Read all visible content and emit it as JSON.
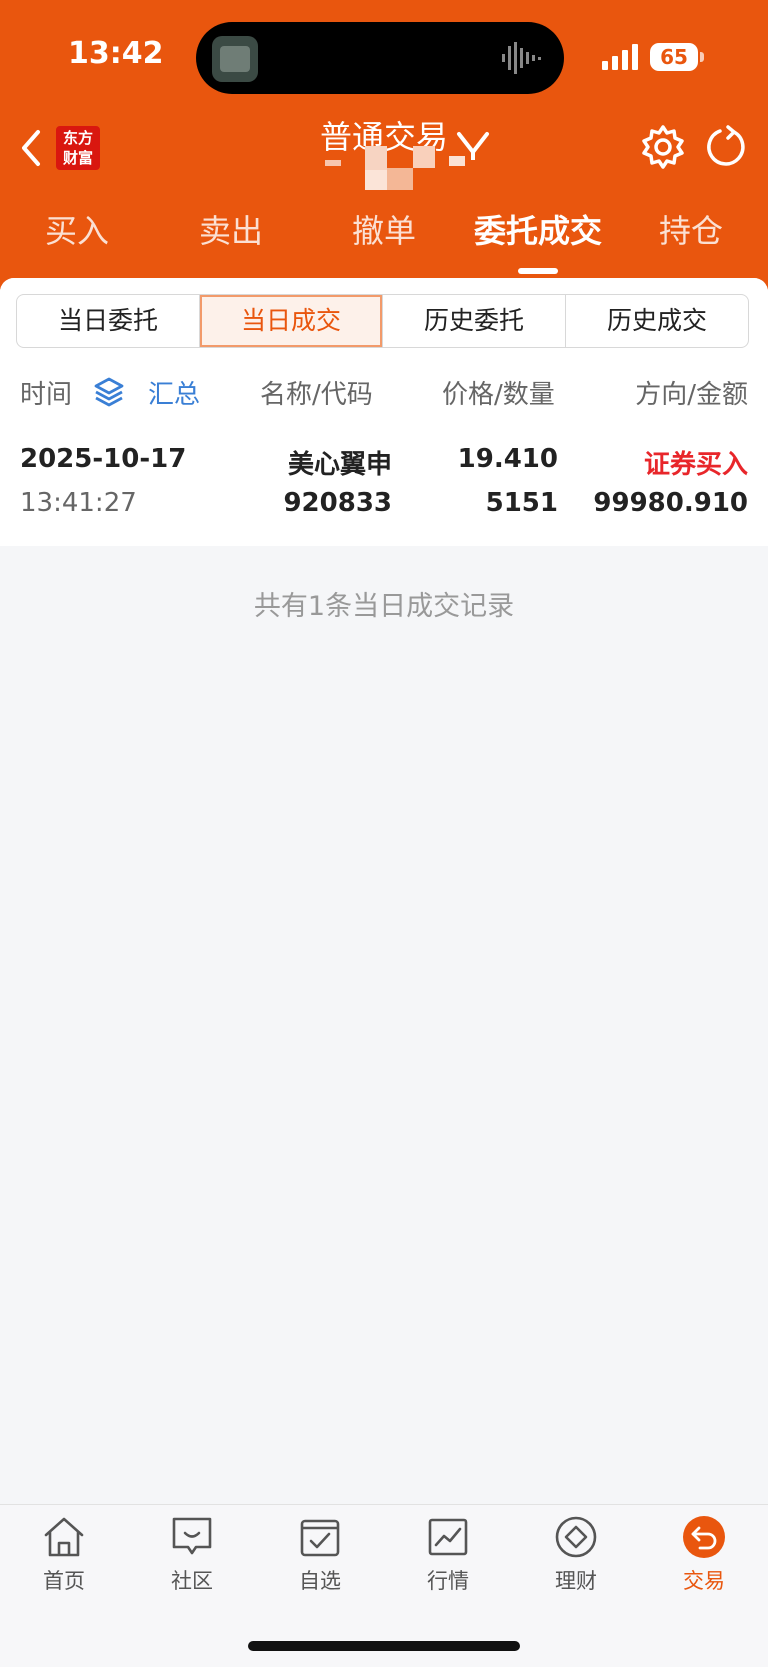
{
  "status_bar": {
    "time": "13:42",
    "battery": "65"
  },
  "header": {
    "logo_line1": "东方",
    "logo_line2": "财富",
    "title": "普通交易"
  },
  "main_tabs": [
    {
      "label": "买入"
    },
    {
      "label": "卖出"
    },
    {
      "label": "撤单"
    },
    {
      "label": "委托成交",
      "active": true
    },
    {
      "label": "持仓"
    }
  ],
  "sub_tabs": [
    {
      "label": "当日委托"
    },
    {
      "label": "当日成交",
      "active": true
    },
    {
      "label": "历史委托"
    },
    {
      "label": "历史成交"
    }
  ],
  "columns": {
    "time": "时间",
    "summary": "汇总",
    "name_code": "名称/代码",
    "price_qty": "价格/数量",
    "dir_amount": "方向/金额"
  },
  "trades": [
    {
      "date": "2025-10-17",
      "time": "13:41:27",
      "name": "美心翼申",
      "code": "920833",
      "price": "19.410",
      "quantity": "5151",
      "direction": "证券买入",
      "amount": "99980.910"
    }
  ],
  "footer_note": "共有1条当日成交记录",
  "bottom_nav": [
    {
      "label": "首页",
      "icon": "home-icon"
    },
    {
      "label": "社区",
      "icon": "community-icon"
    },
    {
      "label": "自选",
      "icon": "watchlist-icon"
    },
    {
      "label": "行情",
      "icon": "market-icon"
    },
    {
      "label": "理财",
      "icon": "wealth-icon"
    },
    {
      "label": "交易",
      "icon": "trade-icon",
      "active": true
    }
  ],
  "colors": {
    "brand": "#e9560e",
    "buy": "#e8262a",
    "link": "#3a7fd5"
  }
}
